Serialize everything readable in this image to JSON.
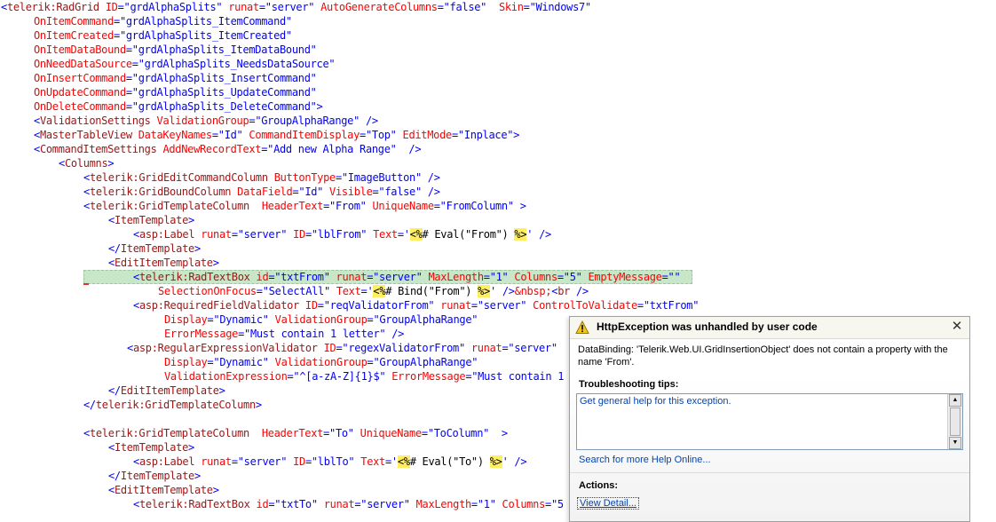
{
  "editor": {
    "lines": [
      {
        "indent": 1,
        "segments": [
          [
            "t",
            "<"
          ],
          [
            "n",
            "telerik:RadGrid"
          ],
          [
            "a",
            " ID"
          ],
          [
            "t",
            "=\"grdAlphaSplits\""
          ],
          [
            "a",
            " runat"
          ],
          [
            "t",
            "=\"server\""
          ],
          [
            "a",
            " AutoGenerateColumns"
          ],
          [
            "t",
            "=\"false\""
          ],
          [
            "a",
            "  Skin"
          ],
          [
            "t",
            "=\"Windows7\""
          ]
        ]
      },
      {
        "indent": 38,
        "segments": [
          [
            "a",
            "OnItemCommand"
          ],
          [
            "t",
            "=\"grdAlphaSplits_ItemCommand\""
          ]
        ]
      },
      {
        "indent": 38,
        "segments": [
          [
            "a",
            "OnItemCreated"
          ],
          [
            "t",
            "=\"grdAlphaSplits_ItemCreated\""
          ]
        ]
      },
      {
        "indent": 38,
        "segments": [
          [
            "a",
            "OnItemDataBound"
          ],
          [
            "t",
            "=\"grdAlphaSplits_ItemDataBound\""
          ]
        ]
      },
      {
        "indent": 38,
        "segments": [
          [
            "a",
            "OnNeedDataSource"
          ],
          [
            "t",
            "=\"grdAlphaSplits_NeedsDataSource\""
          ]
        ]
      },
      {
        "indent": 38,
        "segments": [
          [
            "a",
            "OnInsertCommand"
          ],
          [
            "t",
            "=\"grdAlphaSplits_InsertCommand\""
          ]
        ]
      },
      {
        "indent": 38,
        "segments": [
          [
            "a",
            "OnUpdateCommand"
          ],
          [
            "t",
            "=\"grdAlphaSplits_UpdateCommand\""
          ]
        ]
      },
      {
        "indent": 38,
        "segments": [
          [
            "a",
            "OnDeleteCommand"
          ],
          [
            "t",
            "=\"grdAlphaSplits_DeleteCommand\">"
          ]
        ]
      },
      {
        "indent": 38,
        "segments": [
          [
            "t",
            "<"
          ],
          [
            "n",
            "ValidationSettings"
          ],
          [
            "a",
            " ValidationGroup"
          ],
          [
            "t",
            "=\"GroupAlphaRange\" />"
          ]
        ]
      },
      {
        "indent": 38,
        "segments": [
          [
            "t",
            "<"
          ],
          [
            "n",
            "MasterTableView"
          ],
          [
            "a",
            " DataKeyNames"
          ],
          [
            "t",
            "=\"Id\""
          ],
          [
            "a",
            " CommandItemDisplay"
          ],
          [
            "t",
            "=\"Top\""
          ],
          [
            "a",
            " EditMode"
          ],
          [
            "t",
            "=\"Inplace\">"
          ]
        ]
      },
      {
        "indent": 38,
        "segments": [
          [
            "t",
            "<"
          ],
          [
            "n",
            "CommandItemSettings"
          ],
          [
            "a",
            " AddNewRecordText"
          ],
          [
            "t",
            "=\"Add new Alpha Range\"  />"
          ]
        ]
      },
      {
        "indent": 66,
        "segments": [
          [
            "t",
            "<"
          ],
          [
            "n",
            "Columns"
          ],
          [
            "t",
            ">"
          ]
        ]
      },
      {
        "indent": 94,
        "segments": [
          [
            "t",
            "<"
          ],
          [
            "n",
            "telerik:GridEditCommandColumn"
          ],
          [
            "a",
            " ButtonType"
          ],
          [
            "t",
            "=\"ImageButton\" />"
          ]
        ]
      },
      {
        "indent": 94,
        "segments": [
          [
            "t",
            "<"
          ],
          [
            "n",
            "telerik:GridBoundColumn"
          ],
          [
            "a",
            " DataField"
          ],
          [
            "t",
            "=\"Id\""
          ],
          [
            "a",
            " Visible"
          ],
          [
            "t",
            "=\"false\" />"
          ]
        ]
      },
      {
        "indent": 94,
        "segments": [
          [
            "t",
            "<"
          ],
          [
            "n",
            "telerik:GridTemplateColumn"
          ],
          [
            "a",
            "  HeaderText"
          ],
          [
            "t",
            "=\"From\""
          ],
          [
            "a",
            " UniqueName"
          ],
          [
            "t",
            "=\"FromColumn\" >"
          ]
        ]
      },
      {
        "indent": 122,
        "segments": [
          [
            "t",
            "<"
          ],
          [
            "n",
            "ItemTemplate"
          ],
          [
            "t",
            ">"
          ]
        ]
      },
      {
        "indent": 150,
        "segments": [
          [
            "t",
            "<"
          ],
          [
            "n",
            "asp:Label"
          ],
          [
            "a",
            " runat"
          ],
          [
            "t",
            "=\"server\""
          ],
          [
            "a",
            " ID"
          ],
          [
            "t",
            "=\"lblFrom\""
          ],
          [
            "a",
            " Text"
          ],
          [
            "t",
            "='"
          ],
          [
            "s",
            "<%"
          ],
          [
            "c",
            "# Eval(\"From\") "
          ],
          [
            "s",
            "%>"
          ],
          [
            "t",
            "' />"
          ]
        ]
      },
      {
        "indent": 122,
        "segments": [
          [
            "t",
            "</"
          ],
          [
            "n",
            "ItemTemplate"
          ],
          [
            "t",
            ">"
          ]
        ]
      },
      {
        "indent": 122,
        "segments": [
          [
            "t",
            "<"
          ],
          [
            "n",
            "EditItemTemplate"
          ],
          [
            "t",
            ">"
          ]
        ]
      },
      {
        "indent": 150,
        "hl": true,
        "segments": [
          [
            "t",
            "<"
          ],
          [
            "n",
            "telerik:RadTextBox"
          ],
          [
            "a",
            " id"
          ],
          [
            "t",
            "=\"txtFrom\""
          ],
          [
            "a",
            " runat"
          ],
          [
            "t",
            "=\"server\""
          ],
          [
            "a",
            " MaxLength"
          ],
          [
            "t",
            "=\"1\""
          ],
          [
            "a",
            " Columns"
          ],
          [
            "t",
            "=\"5\""
          ],
          [
            "a",
            " EmptyMessage"
          ],
          [
            "t",
            "=\"\""
          ]
        ]
      },
      {
        "indent": 178,
        "segments": [
          [
            "a",
            "SelectionOnFocus"
          ],
          [
            "t",
            "=\"SelectAll\""
          ],
          [
            "a",
            " Text"
          ],
          [
            "t",
            "='"
          ],
          [
            "s",
            "<%"
          ],
          [
            "c",
            "# Bind(\"From\") "
          ],
          [
            "s",
            "%>"
          ],
          [
            "t",
            "' />"
          ],
          [
            "a",
            "&nbsp;"
          ],
          [
            "t",
            "<"
          ],
          [
            "n",
            "br"
          ],
          [
            "t",
            " />"
          ]
        ]
      },
      {
        "indent": 150,
        "segments": [
          [
            "t",
            "<"
          ],
          [
            "n",
            "asp:RequiredFieldValidator"
          ],
          [
            "a",
            " ID"
          ],
          [
            "t",
            "=\"reqValidatorFrom\""
          ],
          [
            "a",
            " runat"
          ],
          [
            "t",
            "=\"server\""
          ],
          [
            "a",
            " ControlToValidate"
          ],
          [
            "t",
            "=\"txtFrom\""
          ]
        ]
      },
      {
        "indent": 185,
        "segments": [
          [
            "a",
            "Display"
          ],
          [
            "t",
            "=\"Dynamic\""
          ],
          [
            "a",
            " ValidationGroup"
          ],
          [
            "t",
            "=\"GroupAlphaRange\""
          ]
        ]
      },
      {
        "indent": 185,
        "segments": [
          [
            "a",
            "ErrorMessage"
          ],
          [
            "t",
            "=\"Must contain 1 letter\" />"
          ]
        ]
      },
      {
        "indent": 143,
        "segments": [
          [
            "t",
            "<"
          ],
          [
            "n",
            "asp:RegularExpressionValidator"
          ],
          [
            "a",
            " ID"
          ],
          [
            "t",
            "=\"regexValidatorFrom\""
          ],
          [
            "a",
            " runat"
          ],
          [
            "t",
            "=\"server\""
          ]
        ]
      },
      {
        "indent": 185,
        "segments": [
          [
            "a",
            "Display"
          ],
          [
            "t",
            "=\"Dynamic\""
          ],
          [
            "a",
            " ValidationGroup"
          ],
          [
            "t",
            "=\"GroupAlphaRange\""
          ]
        ]
      },
      {
        "indent": 185,
        "segments": [
          [
            "a",
            "ValidationExpression"
          ],
          [
            "t",
            "=\"^[a-zA-Z]{1}$\""
          ],
          [
            "a",
            " ErrorMessage"
          ],
          [
            "t",
            "=\"Must contain 1"
          ]
        ]
      },
      {
        "indent": 122,
        "segments": [
          [
            "t",
            "</"
          ],
          [
            "n",
            "EditItemTemplate"
          ],
          [
            "t",
            ">"
          ]
        ]
      },
      {
        "indent": 94,
        "segments": [
          [
            "t",
            "</"
          ],
          [
            "n",
            "telerik:GridTemplateColumn"
          ],
          [
            "t",
            ">"
          ]
        ]
      },
      {
        "indent": 0,
        "segments": []
      },
      {
        "indent": 94,
        "segments": [
          [
            "t",
            "<"
          ],
          [
            "n",
            "telerik:GridTemplateColumn"
          ],
          [
            "a",
            "  HeaderText"
          ],
          [
            "t",
            "=\"To\""
          ],
          [
            "a",
            " UniqueName"
          ],
          [
            "t",
            "=\"ToColumn\"  >"
          ]
        ]
      },
      {
        "indent": 122,
        "segments": [
          [
            "t",
            "<"
          ],
          [
            "n",
            "ItemTemplate"
          ],
          [
            "t",
            ">"
          ]
        ]
      },
      {
        "indent": 150,
        "segments": [
          [
            "t",
            "<"
          ],
          [
            "n",
            "asp:Label"
          ],
          [
            "a",
            " runat"
          ],
          [
            "t",
            "=\"server\""
          ],
          [
            "a",
            " ID"
          ],
          [
            "t",
            "=\"lblTo\""
          ],
          [
            "a",
            " Text"
          ],
          [
            "t",
            "='"
          ],
          [
            "s",
            "<%"
          ],
          [
            "c",
            "# Eval(\"To\") "
          ],
          [
            "s",
            "%>"
          ],
          [
            "t",
            "' />"
          ]
        ]
      },
      {
        "indent": 122,
        "segments": [
          [
            "t",
            "</"
          ],
          [
            "n",
            "ItemTemplate"
          ],
          [
            "t",
            ">"
          ]
        ]
      },
      {
        "indent": 122,
        "segments": [
          [
            "t",
            "<"
          ],
          [
            "n",
            "EditItemTemplate"
          ],
          [
            "t",
            ">"
          ]
        ]
      },
      {
        "indent": 150,
        "segments": [
          [
            "t",
            "<"
          ],
          [
            "n",
            "telerik:RadTextBox"
          ],
          [
            "a",
            " id"
          ],
          [
            "t",
            "=\"txtTo\""
          ],
          [
            "a",
            " runat"
          ],
          [
            "t",
            "=\"server\""
          ],
          [
            "a",
            " MaxLength"
          ],
          [
            "t",
            "=\"1\""
          ],
          [
            "a",
            " Columns"
          ],
          [
            "t",
            "=\"5"
          ]
        ]
      }
    ]
  },
  "exception": {
    "title": "HttpException was unhandled by user code",
    "close_glyph": "✕",
    "message": "DataBinding: 'Telerik.Web.UI.GridInsertionObject' does not contain a property with the name 'From'.",
    "troubleshooting_title": "Troubleshooting tips:",
    "tip_link": "Get general help for this exception.",
    "help_link": "Search for more Help Online...",
    "actions_title": "Actions:",
    "view_detail": "View Detail..."
  },
  "colors": {
    "tag": "#0000ff",
    "element": "#a31515",
    "attribute": "#ff0000",
    "server_block_bg": "#ffee62",
    "current_line_bg": "#c8e6c8",
    "link": "#0645ad"
  }
}
